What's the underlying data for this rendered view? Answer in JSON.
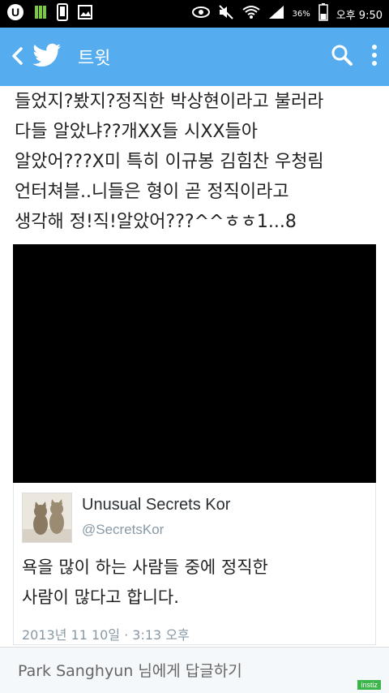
{
  "status_bar": {
    "battery_percent": "36%",
    "time": "오후 9:50",
    "icons": [
      "u-plus-icon",
      "bars-icon",
      "phone-icon",
      "image-icon",
      "eye-icon",
      "mute-icon",
      "wifi-icon",
      "signal-icon",
      "battery-icon"
    ]
  },
  "app_bar": {
    "title": "트윗",
    "color": "#55ACEE",
    "icons": [
      "back-icon",
      "twitter-bird-icon",
      "search-icon",
      "overflow-menu-icon"
    ]
  },
  "tweet": {
    "lines": [
      "들었지?봤지?정직한 박상현이라고 불러라",
      "다들 알았냐??개XX들 시XX들아",
      "알았어???X미 특히 이규봉 김힘찬 우청림",
      "언터쳐블..니들은 형이 곧 정직이라고",
      "생각해 정!직!알았어???^^ㅎㅎ1...8"
    ]
  },
  "quote": {
    "name": "Unusual Secrets Kor",
    "handle": "@SecretsKor",
    "body_lines": [
      "욕을 많이 하는 사람들 중에 정직한",
      "사람이 많다고 합니다."
    ],
    "timestamp": "2013년 11 10일 · 3:13 오후"
  },
  "reply": {
    "placeholder": "Park Sanghyun 님에게 답글하기"
  },
  "watermark": "instiz"
}
